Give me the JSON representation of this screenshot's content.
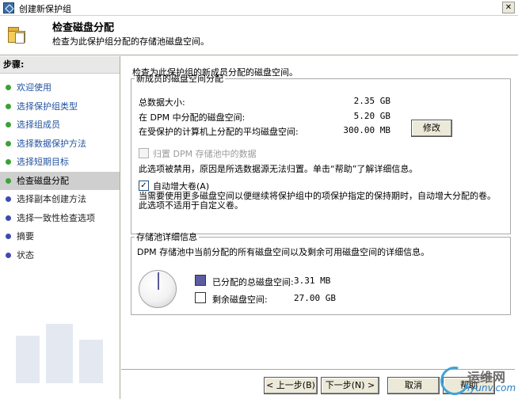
{
  "window": {
    "title": "创建新保护组"
  },
  "header": {
    "title": "检查磁盘分配",
    "subtitle": "检查为此保护组分配的存储池磁盘空间。"
  },
  "sidebar": {
    "title": "步骤:",
    "items": [
      {
        "label": "欢迎使用",
        "state": "done"
      },
      {
        "label": "选择保护组类型",
        "state": "done"
      },
      {
        "label": "选择组成员",
        "state": "done"
      },
      {
        "label": "选择数据保护方法",
        "state": "done"
      },
      {
        "label": "选择短期目标",
        "state": "done"
      },
      {
        "label": "检查磁盘分配",
        "state": "current"
      },
      {
        "label": "选择副本创建方法",
        "state": "future"
      },
      {
        "label": "选择一致性检查选项",
        "state": "future"
      },
      {
        "label": "摘要",
        "state": "future"
      },
      {
        "label": "状态",
        "state": "future"
      }
    ]
  },
  "main": {
    "intro": "检查为此保护组的新成员分配的磁盘空间。",
    "allocation": {
      "legend": "新成员的磁盘空间分配",
      "rows": [
        {
          "label": "总数据大小:",
          "value": "2.35 GB"
        },
        {
          "label": "在 DPM 中分配的磁盘空间:",
          "value": "5.20 GB"
        },
        {
          "label": "在受保护的计算机上分配的平均磁盘空间:",
          "value": "300.00 MB"
        }
      ],
      "modify_button": "修改",
      "colocate_label": "归置 DPM 存储池中的数据",
      "colocate_note": "此选项被禁用，原因是所选数据源无法归置。单击“帮助”了解详细信息。",
      "autogrow_label": "自动增大卷(A)",
      "autogrow_checked": true,
      "autogrow_note": "当需要使用更多磁盘空间以便继续将保护组中的项保护指定的保持期时，自动增大分配的卷。此选项不适用于自定义卷。"
    },
    "storage": {
      "legend": "存储池详细信息",
      "description": "DPM 存储池中当前分配的所有磁盘空间以及剩余可用磁盘空间的详细信息。",
      "allocated_label": "已分配的总磁盘空间:",
      "allocated_value": "3.31 MB",
      "allocated_color": "#5c5ca0",
      "free_label": "剩余磁盘空间:",
      "free_value": "27.00 GB",
      "free_color": "#ffffff"
    }
  },
  "footer": {
    "back": "< 上一步(B)",
    "next": "下一步(N) >",
    "cancel": "取消",
    "help": "帮助"
  },
  "watermark": {
    "text1": "运维网",
    "text2": "iyunv.com"
  }
}
